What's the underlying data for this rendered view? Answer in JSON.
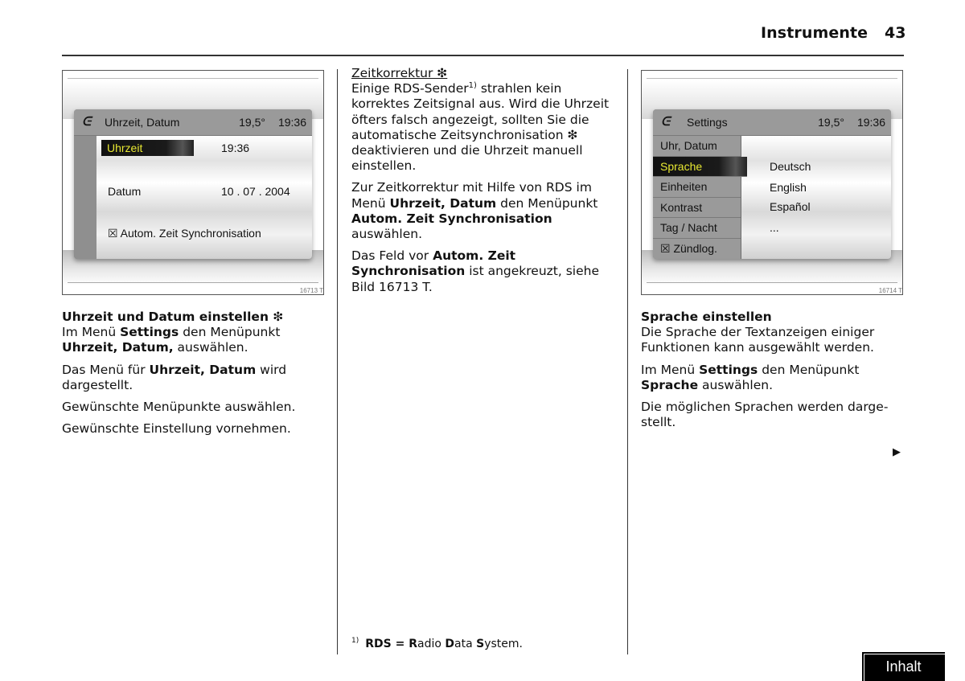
{
  "header": {
    "section_title": "Instrumente",
    "page_number": "43"
  },
  "figure1": {
    "id": "16713 T",
    "screen": {
      "logo_icon": "vehicle-logo-icon",
      "title": "Uhrzeit, Datum",
      "temperature": "19,5°",
      "clock": "19:36",
      "rows": [
        {
          "label": "Uhrzeit",
          "value": "19:36",
          "selected": true
        },
        {
          "label": "Datum",
          "value": "10 . 07 . 2004",
          "selected": false
        }
      ],
      "checkbox_label": "☒ Autom. Zeit Synchronisation"
    }
  },
  "figure2": {
    "id": "16714 T",
    "screen": {
      "title": "Settings",
      "temperature": "19,5°",
      "clock": "19:36",
      "menu": [
        {
          "label": "Uhr, Datum",
          "active": false
        },
        {
          "label": "Sprache",
          "active": true
        },
        {
          "label": "Einheiten",
          "active": false
        },
        {
          "label": "Kontrast",
          "active": false
        },
        {
          "label": "Tag / Nacht",
          "active": false
        },
        {
          "label": "☒ Zündlog.",
          "active": false
        }
      ],
      "languages": [
        "Deutsch",
        "English",
        "Español",
        "..."
      ]
    }
  },
  "column1": {
    "heading": "Uhrzeit und Datum einstellen ❇",
    "p1": {
      "a": "Im Menü ",
      "b1": "Settings",
      "c": " den Menüpunkt ",
      "b2": "Uhrzeit, Datum,",
      "d": " auswählen."
    },
    "p2": {
      "a": "Das Menü für ",
      "b": "Uhrzeit, Datum",
      "c": " wird darge­stellt."
    },
    "p3": "Gewünschte Menüpunkte auswählen.",
    "p4": "Gewünschte Einstellung vornehmen."
  },
  "column2": {
    "heading": "Zeitkorrektur ❇",
    "p1": {
      "a": "Einige RDS-Sender",
      "sup": "1)",
      "b": " strahlen kein korrektes Zeitsignal aus. Wird die Uhrzeit öfters falsch angezeigt, sollten Sie die automati­sche Zeitsynchronisation ❇ deaktivieren und die Uhrzeit manuell einstellen."
    },
    "p2": {
      "a": "Zur Zeitkorrektur mit Hilfe von RDS im Menü ",
      "b1": "Uhrzeit, Datum",
      "c": " den Menüpunkt ",
      "b2": "Au­tom. Zeit Synchronisation",
      "d": " auswählen."
    },
    "p3": {
      "a": "Das Feld vor ",
      "b": "Autom. Zeit Synchronisation",
      "c": " ist angekreuzt, siehe Bild 16713 T."
    }
  },
  "column3": {
    "heading": "Sprache einstellen",
    "p1": "Die Sprache der Textanzeigen einiger Funktionen kann ausgewählt werden.",
    "p2": {
      "a": "Im Menü ",
      "b1": "Settings",
      "c": " den Menüpunkt ",
      "b2": "Sprache",
      "d": " auswählen."
    },
    "p3": "Die möglichen Sprachen werden darge­stellt."
  },
  "footnote": {
    "marker": "1)",
    "b1": "RDS = R",
    "a1": "adio ",
    "b2": "D",
    "a2": "ata ",
    "b3": "S",
    "a3": "ystem."
  },
  "nav": {
    "next_icon": "▶",
    "contents_button": "Inhalt"
  }
}
